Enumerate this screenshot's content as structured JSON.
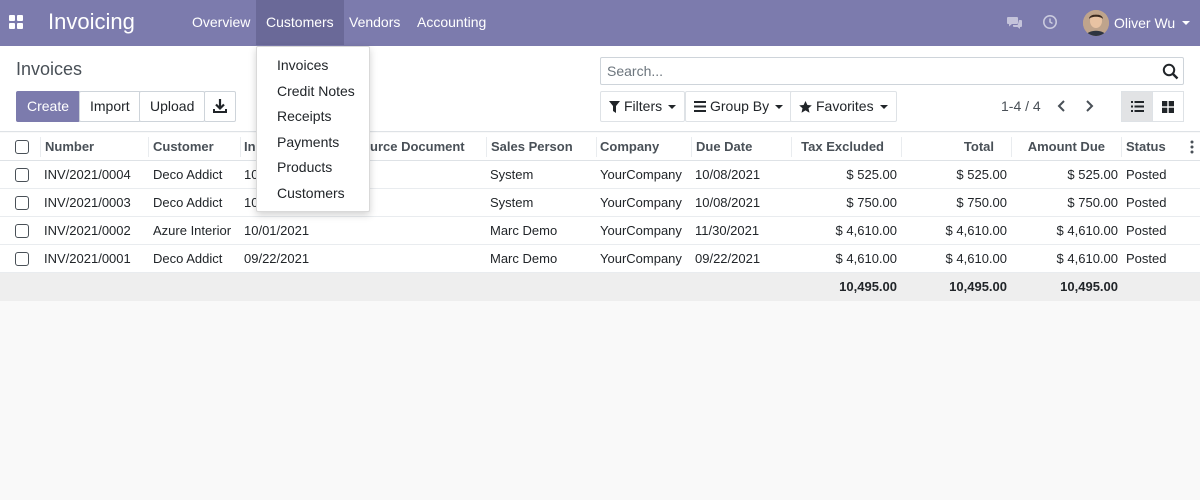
{
  "navbar": {
    "brand": "Invoicing",
    "items": [
      {
        "label": "Overview"
      },
      {
        "label": "Customers"
      },
      {
        "label": "Vendors"
      },
      {
        "label": "Accounting"
      }
    ],
    "user_name": "Oliver Wu",
    "icons": [
      "apps-icon",
      "chat-icon",
      "clock-icon",
      "avatar",
      "caret-down-icon"
    ]
  },
  "dropdown": {
    "items": [
      "Invoices",
      "Credit Notes",
      "Receipts",
      "Payments",
      "Products",
      "Customers"
    ]
  },
  "control": {
    "title": "Invoices",
    "buttons": {
      "create": "Create",
      "import": "Import",
      "upload": "Upload"
    },
    "search_placeholder": "Search...",
    "filters": "Filters",
    "group_by": "Group By",
    "favorites": "Favorites",
    "pager": "1-4 / 4"
  },
  "table": {
    "headers": [
      "Number",
      "Customer",
      "In",
      "urce Document",
      "Sales Person",
      "Company",
      "Due Date",
      "Tax Excluded",
      "Total",
      "Amount Due",
      "Status"
    ],
    "rows": [
      [
        "INV/2021/0004",
        "Deco Addict",
        "10",
        "",
        "System",
        "YourCompany",
        "10/08/2021",
        "$ 525.00",
        "$ 525.00",
        "$ 525.00",
        "Posted"
      ],
      [
        "INV/2021/0003",
        "Deco Addict",
        "10",
        "",
        "System",
        "YourCompany",
        "10/08/2021",
        "$ 750.00",
        "$ 750.00",
        "$ 750.00",
        "Posted"
      ],
      [
        "INV/2021/0002",
        "Azure Interior",
        "10/01/2021",
        "",
        "Marc Demo",
        "YourCompany",
        "11/30/2021",
        "$ 4,610.00",
        "$ 4,610.00",
        "$ 4,610.00",
        "Posted"
      ],
      [
        "INV/2021/0001",
        "Deco Addict",
        "09/22/2021",
        "",
        "Marc Demo",
        "YourCompany",
        "09/22/2021",
        "$ 4,610.00",
        "$ 4,610.00",
        "$ 4,610.00",
        "Posted"
      ]
    ],
    "totals": {
      "tax_excluded": "10,495.00",
      "total": "10,495.00",
      "amount_due": "10,495.00"
    }
  },
  "colors": {
    "brand": "#7c7bad",
    "brand_dark": "#6a6998"
  }
}
